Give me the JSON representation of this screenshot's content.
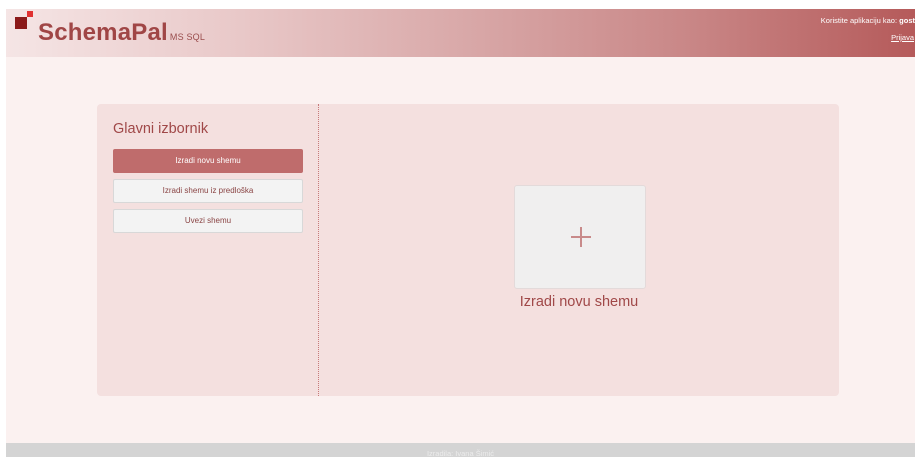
{
  "header": {
    "brand": "SchemaPal",
    "brand_sub": "MS SQL",
    "user_prefix": "Koristite aplikaciju kao: ",
    "user_name": "gost",
    "login_label": "Prijava"
  },
  "menu": {
    "title": "Glavni izbornik",
    "items": [
      {
        "label": "Izradi novu shemu",
        "active": true
      },
      {
        "label": "Izradi shemu iz predloška",
        "active": false
      },
      {
        "label": "Uvezi shemu",
        "active": false
      }
    ]
  },
  "main": {
    "tile_label": "Izradi novu shemu",
    "tile_icon": "plus-icon"
  },
  "footer": {
    "text": "Izradila: Ivana Šimić"
  },
  "colors": {
    "accent": "#bf6c6c",
    "title_text": "#a04848",
    "logo_dark": "#8b1a1a",
    "logo_light": "#e03030"
  }
}
